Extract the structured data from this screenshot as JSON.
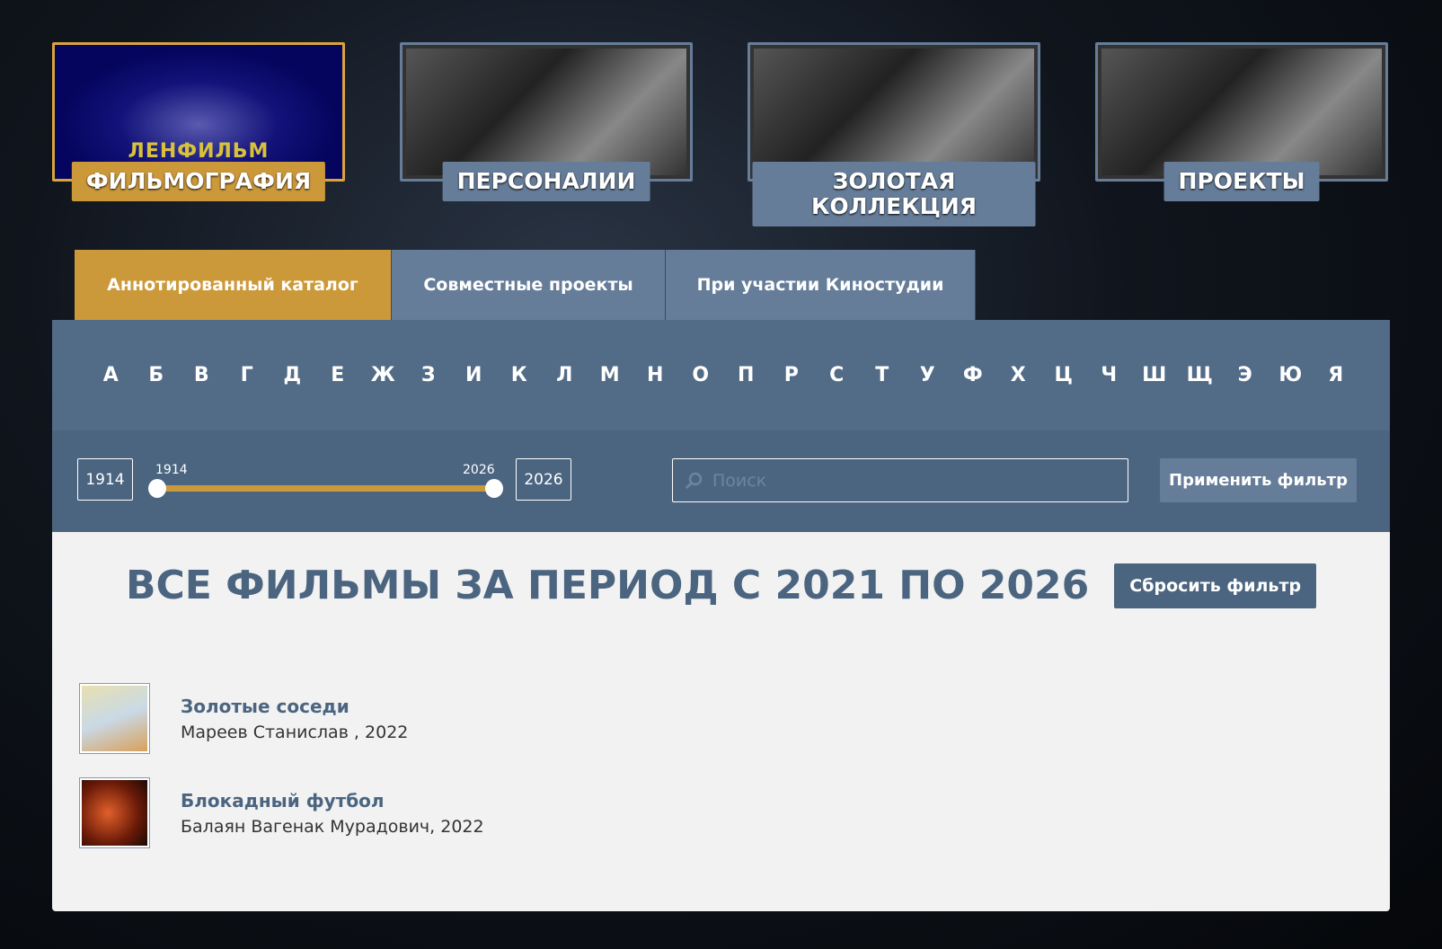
{
  "categories": [
    {
      "label": "ФИЛЬМОГРАФИЯ",
      "logo": "ЛЕНФИЛЬМ",
      "active": true
    },
    {
      "label": "ПЕРСОНАЛИИ"
    },
    {
      "label": "ЗОЛОТАЯ КОЛЛЕКЦИЯ"
    },
    {
      "label": "ПРОЕКТЫ"
    }
  ],
  "tabs": [
    "Аннотированный каталог",
    "Совместные проекты",
    "При участии Киностудии"
  ],
  "letters": [
    "А",
    "Б",
    "В",
    "Г",
    "Д",
    "Е",
    "Ж",
    "З",
    "И",
    "К",
    "Л",
    "М",
    "Н",
    "О",
    "П",
    "Р",
    "С",
    "Т",
    "У",
    "Ф",
    "Х",
    "Ц",
    "Ч",
    "Ш",
    "Щ",
    "Э",
    "Ю",
    "Я"
  ],
  "filter": {
    "min_year": "1914",
    "max_year": "2026",
    "slider_min_label": "1914",
    "slider_max_label": "2026",
    "search_placeholder": "Поиск",
    "apply_label": "Применить фильтр"
  },
  "results": {
    "title": "ВСЕ ФИЛЬМЫ ЗА ПЕРИОД С 2021 ПО 2026",
    "reset_label": "Сбросить фильтр",
    "films": [
      {
        "title": "Золотые соседи",
        "meta": "Мареев Станислав , 2022"
      },
      {
        "title": "Блокадный футбол",
        "meta": "Балаян Вагенак Мурадович, 2022"
      }
    ]
  },
  "colors": {
    "accent": "#cc993a",
    "slate": "#667d99",
    "panel": "#4b6580"
  }
}
